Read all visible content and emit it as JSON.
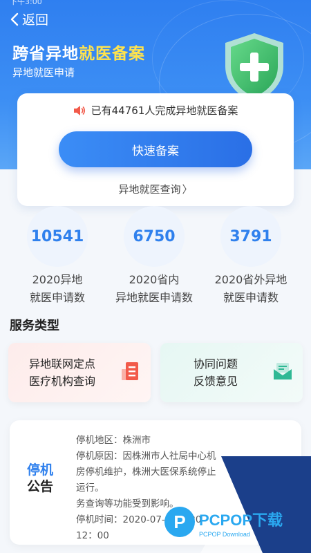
{
  "statusbar": {
    "text": "下午3:00"
  },
  "header": {
    "back_label": "返回",
    "title_prefix": "跨省异地",
    "title_highlight": "就医备案",
    "subtitle": "异地就医申请"
  },
  "card": {
    "notice": "已有44761人完成异地就医备案",
    "quick_button": "快速备案",
    "query_link": "异地就医查询"
  },
  "stats": [
    {
      "value": "10541",
      "label_line1": "2020异地",
      "label_line2": "就医申请数"
    },
    {
      "value": "6750",
      "label_line1": "2020省内",
      "label_line2": "异地就医申请数"
    },
    {
      "value": "3791",
      "label_line1": "2020省外异地",
      "label_line2": "就医申请数"
    }
  ],
  "services": {
    "title": "服务类型",
    "items": [
      {
        "line1": "异地联网定点",
        "line2": "医疗机构查询",
        "icon": "building-icon"
      },
      {
        "line1": "协同问题",
        "line2": "反馈意见",
        "icon": "envelope-icon"
      }
    ]
  },
  "announcement": {
    "badge_line1": "停机",
    "badge_line2": "公告",
    "region": "停机地区：株洲市",
    "reason": "停机原因：因株洲市人社局中心机房停机维护，株洲大医保系统停止运行。",
    "impact": "务查询等功能受到影响。",
    "time": "停机时间：2020-07-",
    "time_rest": "00-20",
    "time_end": "12：00"
  },
  "watermark": {
    "brand": "PCPOP下载",
    "sub": "PCPOP Download"
  },
  "colors": {
    "primary": "#2f80ed",
    "highlight": "#ffe34d",
    "shield": "#3fbf6a"
  }
}
